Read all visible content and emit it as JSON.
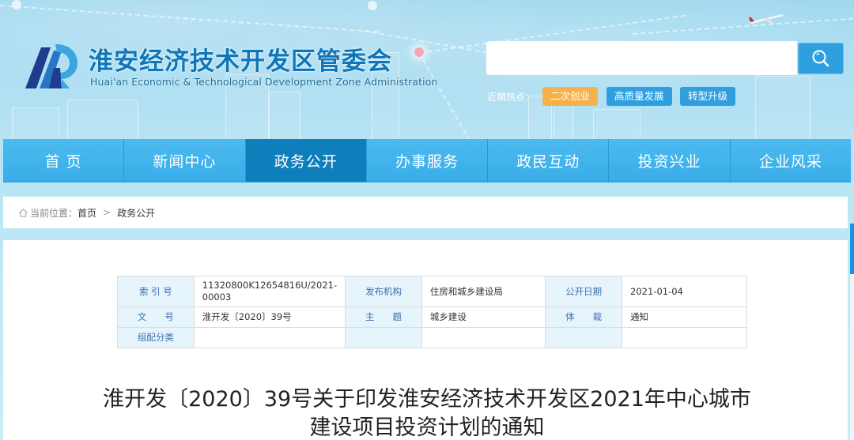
{
  "header": {
    "site_title": "淮安经济技术开发区管委会",
    "site_subtitle": "Huai'an Economic & Technological Development Zone Administration",
    "logo_icon": "hda-logo",
    "search": {
      "value": "",
      "placeholder": "",
      "button_icon": "search-icon"
    },
    "hot_topics": {
      "label": "近期热点：",
      "tags": [
        {
          "label": "二次创业",
          "color": "#f6b24a"
        },
        {
          "label": "高质量发展",
          "color": "#2f9fe0"
        },
        {
          "label": "转型升级",
          "color": "#2f9fe0"
        }
      ]
    }
  },
  "nav": {
    "active_index": 2,
    "active_color": "#0f7fbb",
    "base_color": "#3cb2ea",
    "items": [
      {
        "label": "首 页"
      },
      {
        "label": "新闻中心"
      },
      {
        "label": "政务公开"
      },
      {
        "label": "办事服务"
      },
      {
        "label": "政民互动"
      },
      {
        "label": "投资兴业"
      },
      {
        "label": "企业风采"
      }
    ]
  },
  "breadcrumb": {
    "icon": "home-icon",
    "prefix": "当前位置：",
    "items": [
      "首页",
      "政务公开"
    ],
    "separator": ">"
  },
  "meta_table": {
    "rows": [
      [
        {
          "label": "索 引 号",
          "value": "11320800K12654816U/2021-00003"
        },
        {
          "label": "发布机构",
          "value": "住房和城乡建设局"
        },
        {
          "label": "公开日期",
          "value": "2021-01-04"
        }
      ],
      [
        {
          "label": "文　　号",
          "value": "淮开发〔2020〕39号"
        },
        {
          "label": "主　　题",
          "value": "城乡建设"
        },
        {
          "label": "体　　裁",
          "value": "通知"
        }
      ],
      [
        {
          "label": "组配分类",
          "value": ""
        },
        {
          "label": "",
          "value": ""
        },
        {
          "label": "",
          "value": ""
        }
      ]
    ]
  },
  "document": {
    "title_line1": "淮开发〔2020〕39号关于印发淮安经济技术开发区2021年中心城市",
    "title_line2": "建设项目投资计划的通知"
  }
}
